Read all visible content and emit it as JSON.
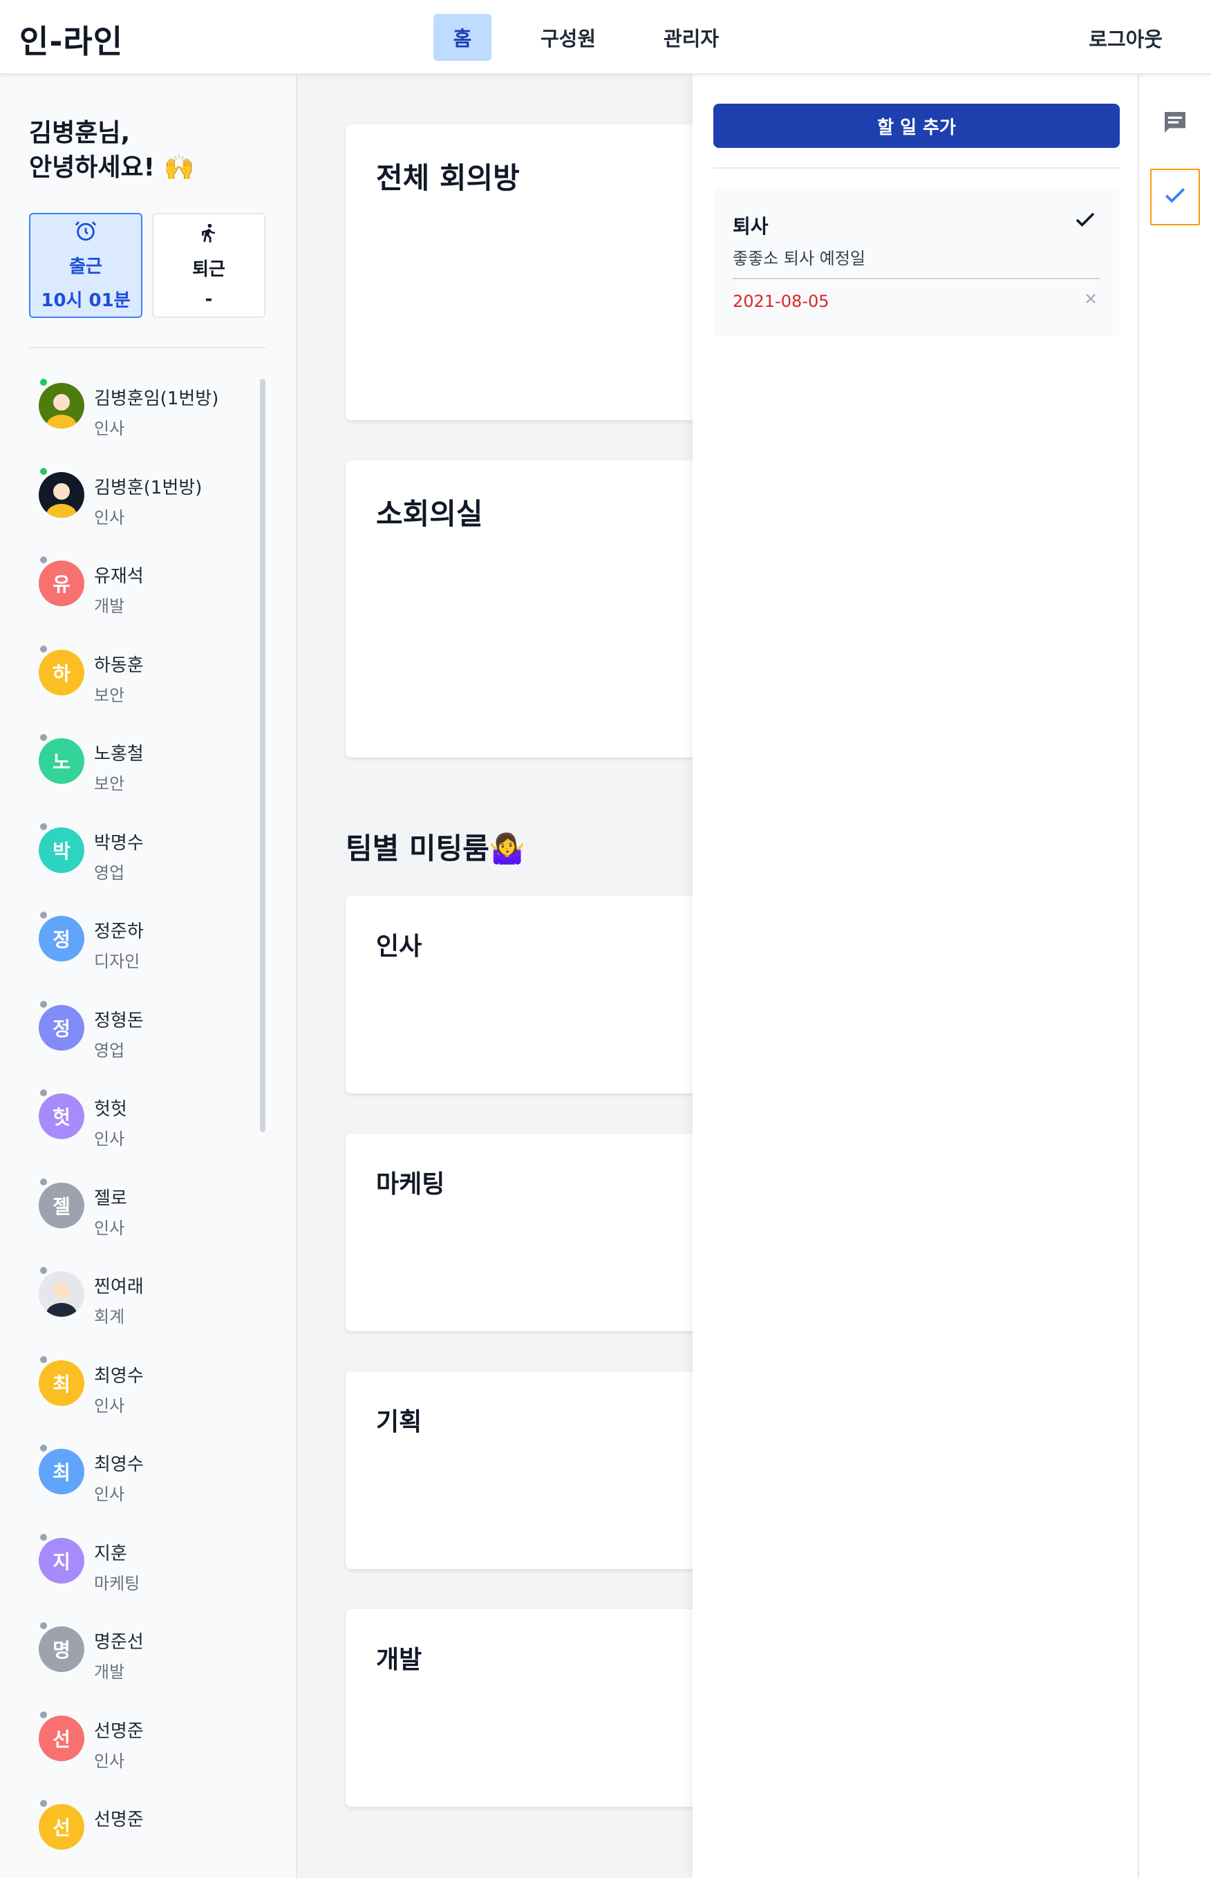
{
  "nav": {
    "logo": "인-라인",
    "tabs": [
      {
        "label": "홈",
        "active": true
      },
      {
        "label": "구성원",
        "active": false
      },
      {
        "label": "관리자",
        "active": false
      }
    ],
    "logout": "로그아웃"
  },
  "sidebar": {
    "greeting_line1": "김병훈님,",
    "greeting_line2": "안녕하세요! 🙌",
    "checkin": {
      "icon": "alarm-clock-icon",
      "label": "출근",
      "value": "10시 01분"
    },
    "checkout": {
      "icon": "running-icon",
      "label": "퇴근",
      "value": "-"
    },
    "members": [
      {
        "name": "김병훈임(1번방)",
        "dept": "인사",
        "initial": "",
        "color": "#4d7c0f",
        "online": true,
        "image": "avatar-image"
      },
      {
        "name": "김병훈(1번방)",
        "dept": "인사",
        "initial": "",
        "color": "#111827",
        "online": true,
        "image": "avatar-image"
      },
      {
        "name": "유재석",
        "dept": "개발",
        "initial": "유",
        "color": "#f87171",
        "online": false
      },
      {
        "name": "하동훈",
        "dept": "보안",
        "initial": "하",
        "color": "#fbbf24",
        "online": false
      },
      {
        "name": "노홍철",
        "dept": "보안",
        "initial": "노",
        "color": "#34d399",
        "online": false
      },
      {
        "name": "박명수",
        "dept": "영업",
        "initial": "박",
        "color": "#2dd4bf",
        "online": false
      },
      {
        "name": "정준하",
        "dept": "디자인",
        "initial": "정",
        "color": "#60a5fa",
        "online": false
      },
      {
        "name": "정형돈",
        "dept": "영업",
        "initial": "정",
        "color": "#818cf8",
        "online": false
      },
      {
        "name": "헛헛",
        "dept": "인사",
        "initial": "헛",
        "color": "#a78bfa",
        "online": false
      },
      {
        "name": "젤로",
        "dept": "인사",
        "initial": "젤",
        "color": "#9ca3af",
        "online": false
      },
      {
        "name": "찐여래",
        "dept": "회계",
        "initial": "",
        "color": "#e5e7eb",
        "online": false,
        "image": "avatar-image"
      },
      {
        "name": "최영수",
        "dept": "인사",
        "initial": "최",
        "color": "#fbbf24",
        "online": false
      },
      {
        "name": "최영수",
        "dept": "인사",
        "initial": "최",
        "color": "#60a5fa",
        "online": false
      },
      {
        "name": "지훈",
        "dept": "마케팅",
        "initial": "지",
        "color": "#a78bfa",
        "online": false
      },
      {
        "name": "명준선",
        "dept": "개발",
        "initial": "명",
        "color": "#9ca3af",
        "online": false
      },
      {
        "name": "선명준",
        "dept": "인사",
        "initial": "선",
        "color": "#f87171",
        "online": false
      },
      {
        "name": "선명준",
        "dept": "",
        "initial": "선",
        "color": "#fbbf24",
        "online": false
      }
    ]
  },
  "main": {
    "rooms": [
      {
        "title": "전체 회의방"
      },
      {
        "title": "소회의실"
      }
    ],
    "team_section_title": "팀별 미팅룸🤷‍♀️",
    "teams": [
      {
        "title": "인사"
      },
      {
        "title": "마케팅"
      },
      {
        "title": "기획"
      },
      {
        "title": "개발"
      }
    ]
  },
  "todo": {
    "add_button": "할 일 추가",
    "items": [
      {
        "title": "퇴사",
        "description": "좋좋소 퇴사 예정일",
        "date": "2021-08-05"
      }
    ]
  },
  "rail": {
    "chat_icon": "chat-icon",
    "todo_icon": "checkmark-icon"
  }
}
